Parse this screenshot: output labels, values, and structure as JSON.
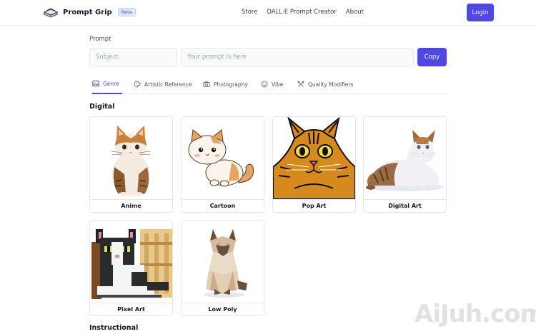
{
  "header": {
    "brand": "Prompt Grip",
    "badge": "Beta",
    "nav": [
      "Store",
      "DALL·E Prompt Creator",
      "About"
    ],
    "login": "Login"
  },
  "prompt": {
    "label": "Prompt",
    "subject_placeholder": "Subject",
    "prompt_placeholder": "Your prompt is here",
    "copy": "Copy"
  },
  "tabs": [
    {
      "label": "Genre",
      "icon": "image-icon",
      "active": true
    },
    {
      "label": "Artistic Reference",
      "icon": "palette-icon",
      "active": false
    },
    {
      "label": "Photography",
      "icon": "camera-icon",
      "active": false
    },
    {
      "label": "Vibe",
      "icon": "smile-icon",
      "active": false
    },
    {
      "label": "Quality Modifiers",
      "icon": "tools-icon",
      "active": false
    }
  ],
  "sections": [
    {
      "title": "Digital",
      "cards": [
        "Anime",
        "Cartoon",
        "Pop Art",
        "Digital Art",
        "Pixel Art",
        "Low Poly"
      ]
    },
    {
      "title": "Instructional"
    }
  ],
  "watermark": "AiJuh.com",
  "colors": {
    "accent": "#4f46e5",
    "border": "#e5e7eb"
  }
}
